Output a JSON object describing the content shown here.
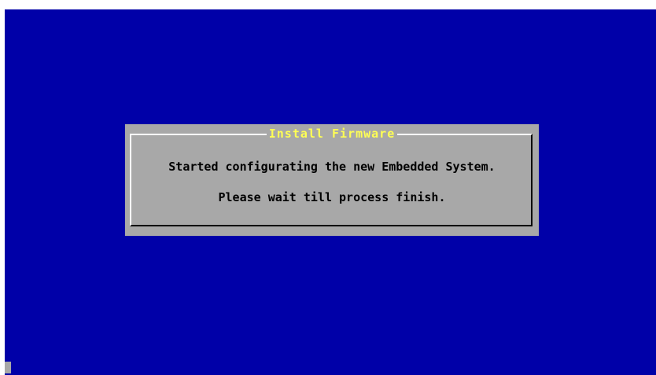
{
  "dialog": {
    "title": "Install Firmware",
    "line1": "Started configurating the new Embedded System.",
    "line2": "Please wait till process finish."
  },
  "colors": {
    "screen_background": "#0000a8",
    "dialog_background": "#a8a8a8",
    "title_color": "#ffff54",
    "text_color": "#000000"
  }
}
